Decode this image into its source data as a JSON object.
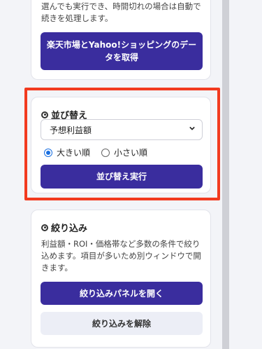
{
  "fetch_card": {
    "description": "選んでも実行でき、時間切れの場合は自動で続きを処理します。",
    "button_label": "楽天市場とYahoo!ショッピングのデータを取得"
  },
  "sort_card": {
    "title": "並び替え",
    "select_value": "予想利益額",
    "radio_desc": "大きい順",
    "radio_asc": "小さい順",
    "button_label": "並び替え実行"
  },
  "filter_card": {
    "title": "絞り込み",
    "description": "利益額・ROI・価格帯など多数の条件で絞り込めます。項目が多いため別ウィンドウで開きます。",
    "open_button": "絞り込みパネルを開く",
    "clear_button": "絞り込みを解除"
  },
  "colors": {
    "primary": "#3a2d9e",
    "highlight": "#f23a1f",
    "radio_selected": "#1a6fe0"
  }
}
